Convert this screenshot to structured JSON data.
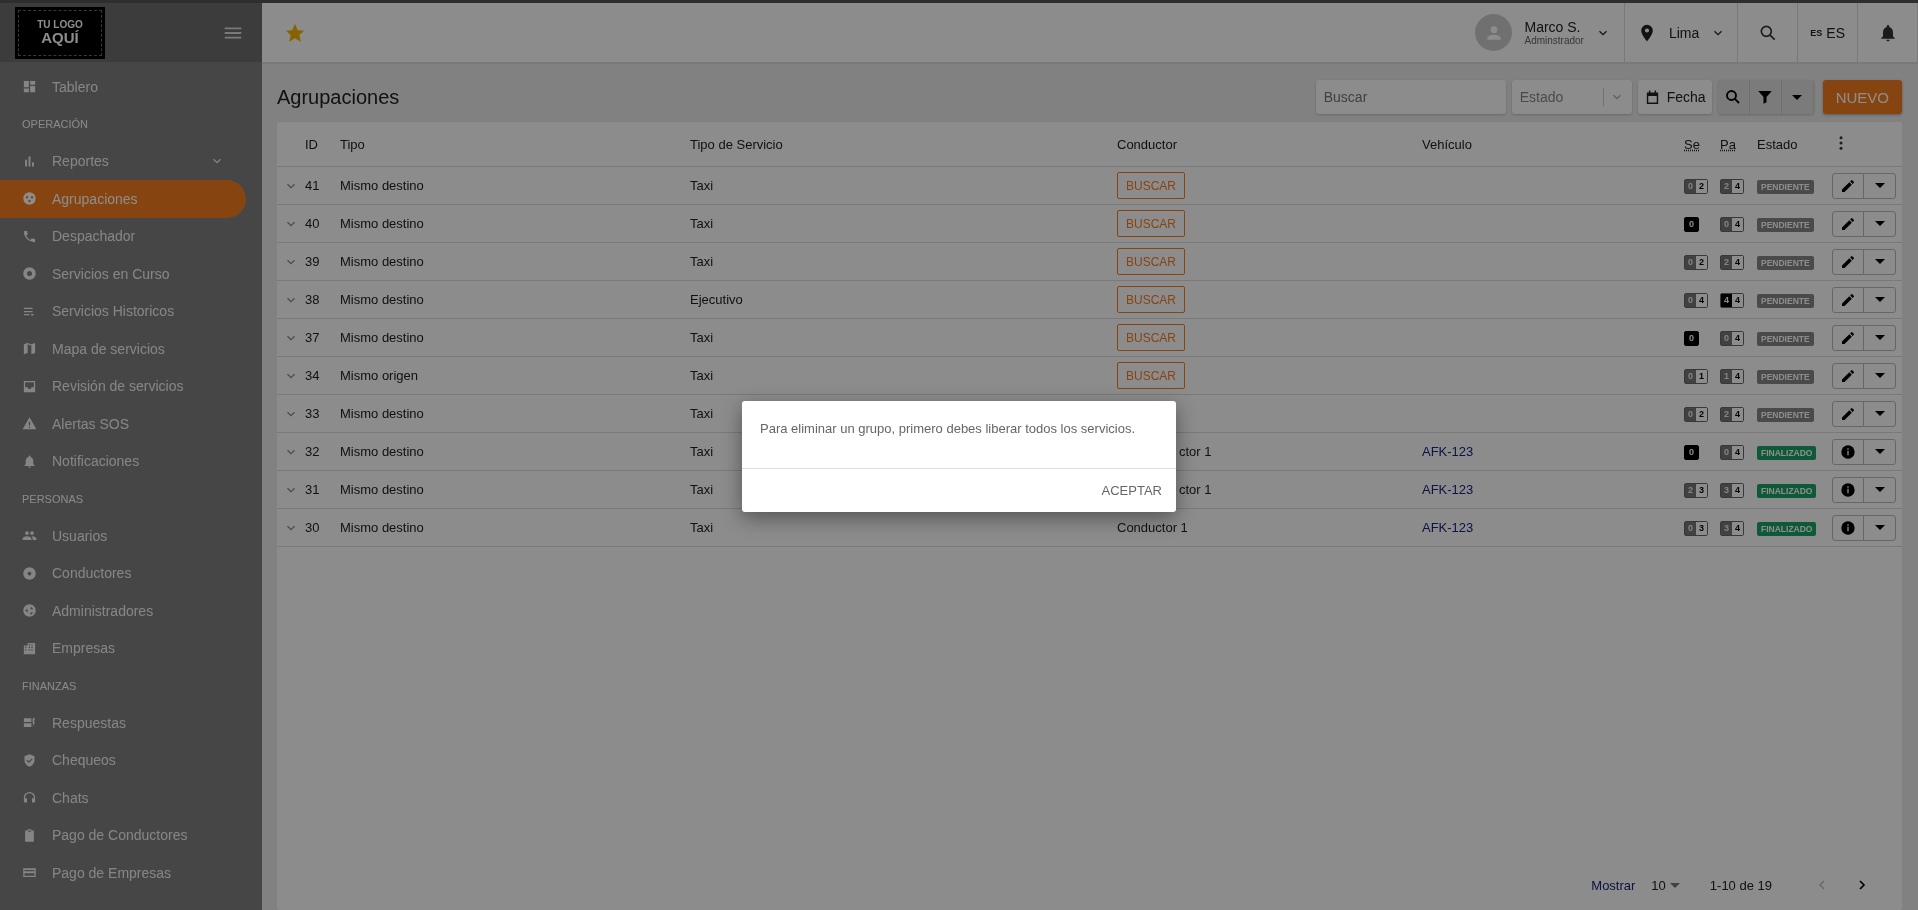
{
  "logo": {
    "line1": "TU LOGO",
    "line2": "AQUÍ"
  },
  "sidebar": {
    "items": [
      {
        "kind": "item",
        "label": "Tablero",
        "selected": false,
        "submenu": false
      },
      {
        "kind": "heading",
        "label": "OPERACIÓN"
      },
      {
        "kind": "item",
        "label": "Reportes",
        "selected": false,
        "submenu": true
      },
      {
        "kind": "item",
        "label": "Agrupaciones",
        "selected": true,
        "submenu": false
      },
      {
        "kind": "item",
        "label": "Despachador",
        "selected": false,
        "submenu": false
      },
      {
        "kind": "item",
        "label": "Servicios en Curso",
        "selected": false,
        "submenu": false
      },
      {
        "kind": "item",
        "label": "Servicios Historicos",
        "selected": false,
        "submenu": false
      },
      {
        "kind": "item",
        "label": "Mapa de servicios",
        "selected": false,
        "submenu": false
      },
      {
        "kind": "item",
        "label": "Revisión de servicios",
        "selected": false,
        "submenu": false
      },
      {
        "kind": "item",
        "label": "Alertas SOS",
        "selected": false,
        "submenu": false
      },
      {
        "kind": "item",
        "label": "Notificaciones",
        "selected": false,
        "submenu": false
      },
      {
        "kind": "heading",
        "label": "PERSONAS"
      },
      {
        "kind": "item",
        "label": "Usuarios",
        "selected": false,
        "submenu": false
      },
      {
        "kind": "item",
        "label": "Conductores",
        "selected": false,
        "submenu": false
      },
      {
        "kind": "item",
        "label": "Administradores",
        "selected": false,
        "submenu": false
      },
      {
        "kind": "item",
        "label": "Empresas",
        "selected": false,
        "submenu": false
      },
      {
        "kind": "heading",
        "label": "FINANZAS"
      },
      {
        "kind": "item",
        "label": "Respuestas",
        "selected": false,
        "submenu": false
      },
      {
        "kind": "item",
        "label": "Chequeos",
        "selected": false,
        "submenu": false
      },
      {
        "kind": "item",
        "label": "Chats",
        "selected": false,
        "submenu": false
      },
      {
        "kind": "item",
        "label": "Pago de Conductores",
        "selected": false,
        "submenu": false
      },
      {
        "kind": "item",
        "label": "Pago de Empresas",
        "selected": false,
        "submenu": false
      }
    ]
  },
  "header": {
    "user": {
      "name": "Marco S.",
      "role": "Adminstrador"
    },
    "city": "Lima",
    "language": {
      "code": "ES",
      "label": "ES"
    }
  },
  "page": {
    "title": "Agrupaciones",
    "search": {
      "placeholder": "Buscar"
    },
    "status_select": {
      "placeholder": "Estado"
    },
    "date_button": "Fecha",
    "new_button": "NUEVO"
  },
  "table": {
    "columns": [
      "ID",
      "Tipo",
      "Tipo de Servicio",
      "Conductor",
      "Vehículo",
      "Se",
      "Pa",
      "Estado"
    ],
    "rows": [
      {
        "id": "41",
        "tipo": "Mismo destino",
        "servicio": "Taxi",
        "conductor": {
          "kind": "button",
          "text": "BUSCAR"
        },
        "se": {
          "kind": "partial",
          "a": "0",
          "b": "2"
        },
        "pa": {
          "kind": "partial",
          "a": "2",
          "b": "4"
        },
        "estado": {
          "kind": "pending",
          "text": "PENDIENTE"
        },
        "action": {
          "kind": "edit"
        }
      },
      {
        "id": "40",
        "tipo": "Mismo destino",
        "servicio": "Taxi",
        "conductor": {
          "kind": "button",
          "text": "BUSCAR"
        },
        "se": {
          "kind": "empty",
          "a": "0"
        },
        "pa": {
          "kind": "partial",
          "a": "0",
          "b": "4"
        },
        "estado": {
          "kind": "pending",
          "text": "PENDIENTE"
        },
        "action": {
          "kind": "edit"
        }
      },
      {
        "id": "39",
        "tipo": "Mismo destino",
        "servicio": "Taxi",
        "conductor": {
          "kind": "button",
          "text": "BUSCAR"
        },
        "se": {
          "kind": "partial",
          "a": "0",
          "b": "2"
        },
        "pa": {
          "kind": "partial",
          "a": "2",
          "b": "4"
        },
        "estado": {
          "kind": "pending",
          "text": "PENDIENTE"
        },
        "action": {
          "kind": "edit"
        }
      },
      {
        "id": "38",
        "tipo": "Mismo destino",
        "servicio": "Ejecutivo",
        "conductor": {
          "kind": "button",
          "text": "BUSCAR"
        },
        "se": {
          "kind": "partial",
          "a": "0",
          "b": "4"
        },
        "pa": {
          "kind": "full",
          "a": "4",
          "b": "4"
        },
        "estado": {
          "kind": "pending",
          "text": "PENDIENTE"
        },
        "action": {
          "kind": "edit"
        }
      },
      {
        "id": "37",
        "tipo": "Mismo destino",
        "servicio": "Taxi",
        "conductor": {
          "kind": "button",
          "text": "BUSCAR"
        },
        "se": {
          "kind": "empty",
          "a": "0"
        },
        "pa": {
          "kind": "partial",
          "a": "0",
          "b": "4"
        },
        "estado": {
          "kind": "pending",
          "text": "PENDIENTE"
        },
        "action": {
          "kind": "edit"
        }
      },
      {
        "id": "34",
        "tipo": "Mismo origen",
        "servicio": "Taxi",
        "conductor": {
          "kind": "button",
          "text": "BUSCAR"
        },
        "se": {
          "kind": "partial",
          "a": "0",
          "b": "1"
        },
        "pa": {
          "kind": "partial",
          "a": "1",
          "b": "4"
        },
        "estado": {
          "kind": "pending",
          "text": "PENDIENTE"
        },
        "action": {
          "kind": "edit"
        }
      },
      {
        "id": "33",
        "tipo": "Mismo destino",
        "servicio": "Taxi",
        "se": {
          "kind": "partial",
          "a": "0",
          "b": "2"
        },
        "pa": {
          "kind": "partial",
          "a": "2",
          "b": "4"
        },
        "estado": {
          "kind": "pending",
          "text": "PENDIENTE"
        },
        "action": {
          "kind": "edit"
        }
      },
      {
        "id": "32",
        "tipo": "Mismo destino",
        "servicio": "Taxi",
        "conductor": {
          "kind": "cut",
          "text": "ctor 1"
        },
        "vehiculo": "AFK-123",
        "se": {
          "kind": "empty",
          "a": "0"
        },
        "pa": {
          "kind": "partial",
          "a": "0",
          "b": "4"
        },
        "estado": {
          "kind": "done",
          "text": "FINALIZADO"
        },
        "action": {
          "kind": "info"
        }
      },
      {
        "id": "31",
        "tipo": "Mismo destino",
        "servicio": "Taxi",
        "conductor": {
          "kind": "cut",
          "text": "ctor 1"
        },
        "vehiculo": "AFK-123",
        "se": {
          "kind": "partial",
          "a": "2",
          "b": "3"
        },
        "pa": {
          "kind": "partial",
          "a": "3",
          "b": "4"
        },
        "estado": {
          "kind": "done",
          "text": "FINALIZADO"
        },
        "action": {
          "kind": "info"
        }
      },
      {
        "id": "30",
        "tipo": "Mismo destino",
        "servicio": "Taxi",
        "conductor": {
          "kind": "text",
          "text": "Conductor 1"
        },
        "vehiculo": "AFK-123",
        "se": {
          "kind": "partial",
          "a": "0",
          "b": "3"
        },
        "pa": {
          "kind": "partial",
          "a": "3",
          "b": "4"
        },
        "estado": {
          "kind": "done",
          "text": "FINALIZADO"
        },
        "action": {
          "kind": "info"
        }
      }
    ]
  },
  "pagination": {
    "label": "Mostrar",
    "page_size": "10",
    "range": "1-10 de 19"
  },
  "dialog": {
    "message": "Para eliminar un grupo, primero debes liberar todos los servicios.",
    "button": "ACEPTAR"
  }
}
